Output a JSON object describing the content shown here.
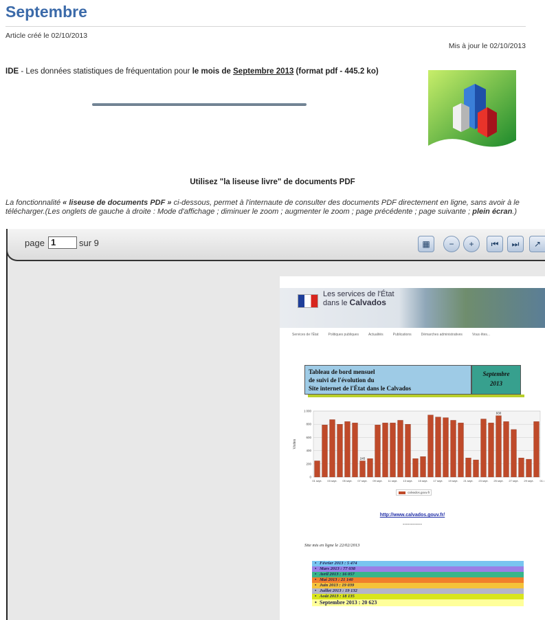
{
  "header": {
    "title": "Septembre",
    "created": "Article créé le 02/10/2013",
    "updated": "Mis à jour le 02/10/2013"
  },
  "intro": {
    "prefix": "IDE",
    "text1": " - Les données statistiques de fréquentation pour ",
    "text2": "le mois de ",
    "link": "Septembre 2013",
    "suffix": " (format pdf - 445.2 ko)"
  },
  "reader": {
    "title": "Utilisez \"la liseuse livre\" de documents PDF",
    "desc_prefix": "La fonctionnalité ",
    "desc_bold1": "« liseuse de documents PDF »",
    "desc_mid": " ci-dessous, permet à l'internaute de consulter des documents PDF directement en ligne, sans avoir à le télécharger.(Les onglets de gauche à droite : Mode d'affichage ; diminuer le zoom ; augmenter le zoom ; page précédente ; page suivante ; ",
    "desc_bold2": "plein écran",
    "desc_end": ".)"
  },
  "toolbar": {
    "page_label": "page",
    "page_value": "1",
    "total_label": "sur 9",
    "buttons": [
      "display-mode-icon",
      "zoom-out-icon",
      "zoom-in-icon",
      "previous-page-icon",
      "next-page-icon",
      "fullscreen-icon"
    ]
  },
  "document": {
    "banner_line1": "Les services de l'État",
    "banner_line2": "dans le",
    "banner_bold": "Calvados",
    "nav": [
      "Services de l'État",
      "Politiques publiques",
      "Actualités",
      "Publications",
      "Démarches administratives",
      "Vous êtes..."
    ],
    "box_title": [
      "Tableau de bord mensuel",
      "de suivi de l'évolution du",
      "Site internet de l'État dans le Calvados"
    ],
    "box_month": [
      "Septembre",
      "2013"
    ],
    "link": "http://www.calvados.gouv.fr/",
    "dash": "------------",
    "online": "Site mis en  ligne le 22/02/2013",
    "stats": [
      {
        "label": "Février 2013 : 5 474",
        "color": "#79c5f0"
      },
      {
        "label": "Mars 2013 : 77 038",
        "color": "#9a7fe6"
      },
      {
        "label": "Avril 2013 : 16 057",
        "color": "#38b58a"
      },
      {
        "label": "Mai 2013 : 21 140",
        "color": "#f07f2c"
      },
      {
        "label": "Juin 2013 : 19 039",
        "color": "#f5c23a"
      },
      {
        "label": "Juillet 2013 : 19 132",
        "color": "#b5b5c8"
      },
      {
        "label": "Août 2013 : 18 135",
        "color": "#d9e51c"
      },
      {
        "label": "Septembre 2013 : 20 623",
        "color": "#ffff9a"
      }
    ]
  },
  "chart_data": {
    "type": "bar",
    "ylabel": "Visites",
    "ylim": [
      0,
      1000
    ],
    "yticks": [
      0,
      200,
      400,
      600,
      800,
      1000
    ],
    "categories": [
      "01 sept.",
      "02 sept.",
      "03 sept.",
      "04 sept.",
      "05 sept.",
      "06 sept.",
      "07 sept.",
      "08 sept.",
      "09 sept.",
      "10 sept.",
      "11 sept.",
      "12 sept.",
      "13 sept.",
      "14 sept.",
      "15 sept.",
      "16 sept.",
      "17 sept.",
      "18 sept.",
      "19 sept.",
      "20 sept.",
      "21 sept.",
      "22 sept.",
      "23 sept.",
      "24 sept.",
      "25 sept.",
      "26 sept.",
      "27 sept.",
      "28 sept.",
      "29 sept.",
      "30 sept."
    ],
    "tick_labels": [
      "01 sept.",
      "03 sept.",
      "05 sept.",
      "07 sept.",
      "09 sept.",
      "11 sept.",
      "13 sept.",
      "15 sept.",
      "17 sept.",
      "19 sept.",
      "21 sept.",
      "23 sept.",
      "25 sept.",
      "27 sept.",
      "29 sept.",
      "01 oct."
    ],
    "values": [
      245,
      790,
      870,
      800,
      840,
      820,
      245,
      280,
      790,
      820,
      820,
      860,
      800,
      280,
      310,
      940,
      910,
      900,
      860,
      820,
      290,
      260,
      880,
      820,
      930,
      840,
      720,
      290,
      270,
      840
    ],
    "labels": [
      {
        "index": 6,
        "text": "245"
      },
      {
        "index": 24,
        "text": "930"
      }
    ],
    "legend": "calvados.gouv.fr",
    "color": "#bf4a2a",
    "grid": true
  }
}
